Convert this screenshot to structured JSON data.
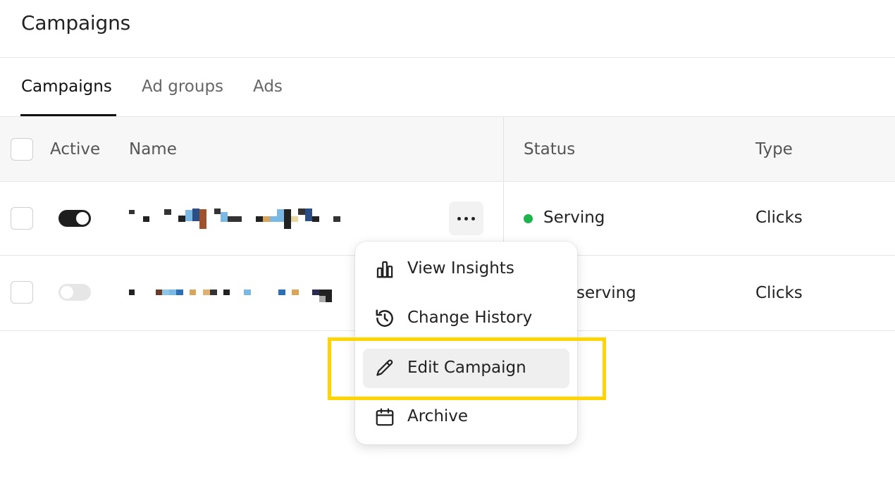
{
  "page": {
    "title": "Campaigns"
  },
  "tabs": [
    {
      "label": "Campaigns",
      "active": true
    },
    {
      "label": "Ad groups",
      "active": false
    },
    {
      "label": "Ads",
      "active": false
    }
  ],
  "table": {
    "columns": {
      "active": "Active",
      "name": "Name",
      "status": "Status",
      "type": "Type"
    },
    "rows": [
      {
        "active": true,
        "name_redacted": true,
        "status": "Serving",
        "status_color": "#1db44b",
        "type": "Clicks"
      },
      {
        "active": false,
        "name_redacted": true,
        "status": "serving",
        "type": "Clicks"
      }
    ]
  },
  "menu": {
    "items": [
      {
        "label": "View Insights",
        "icon": "bar-chart-icon"
      },
      {
        "label": "Change History",
        "icon": "history-icon"
      },
      {
        "label": "Edit Campaign",
        "icon": "pencil-icon",
        "highlighted": true
      },
      {
        "label": "Archive",
        "icon": "calendar-icon"
      }
    ]
  },
  "colors": {
    "highlight": "#ffd400",
    "serving": "#1db44b"
  }
}
